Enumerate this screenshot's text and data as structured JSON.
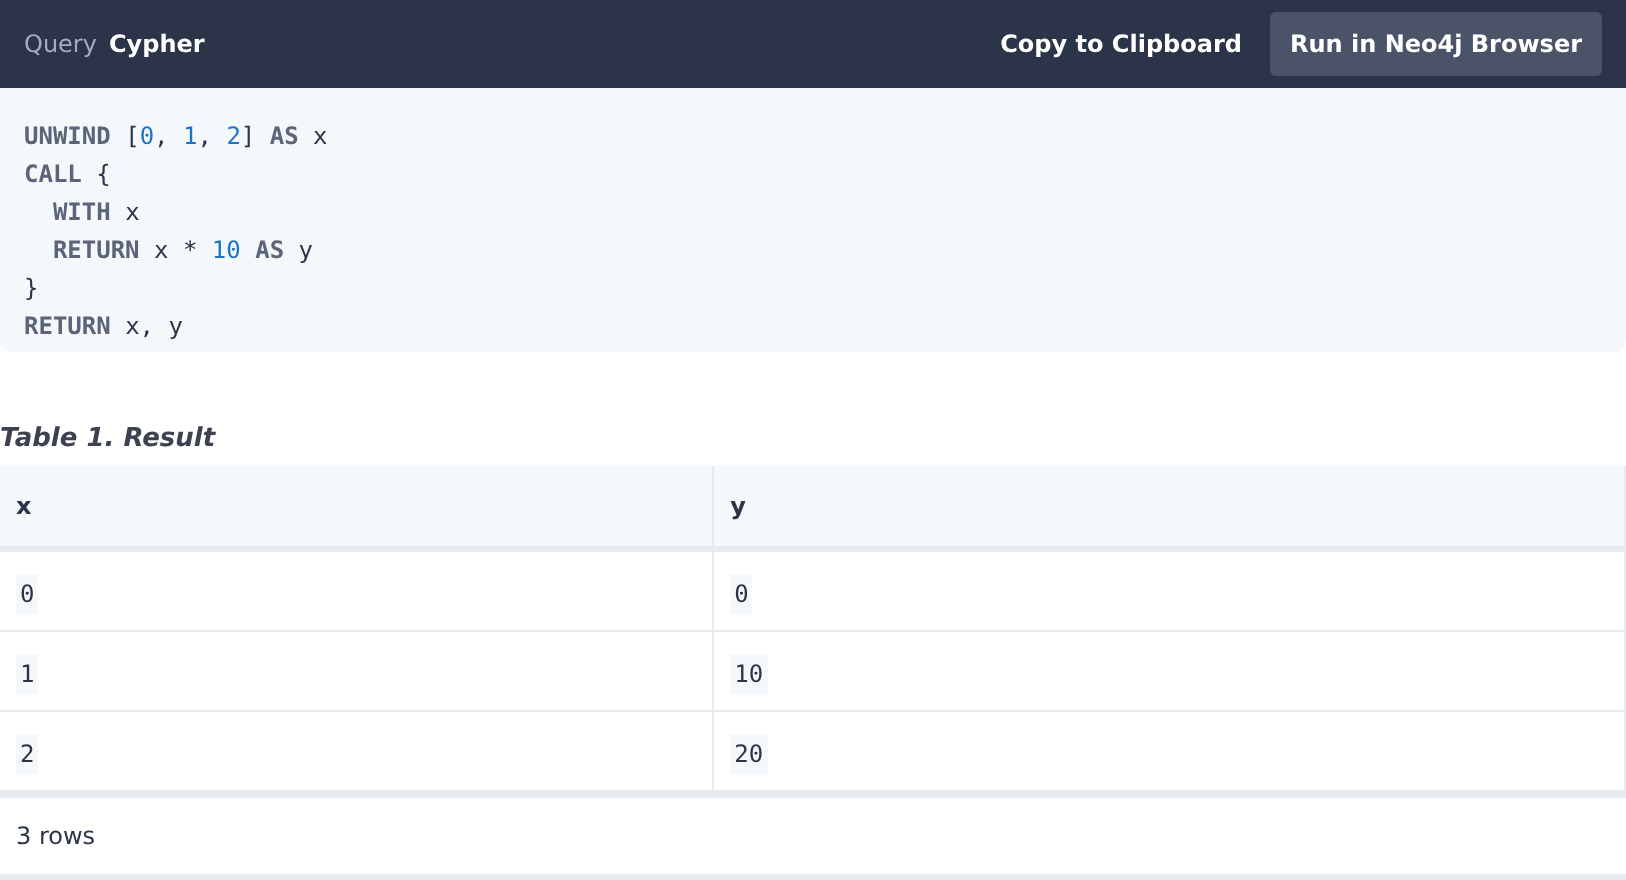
{
  "header": {
    "label": "Query",
    "language": "Cypher",
    "actions": [
      {
        "label": "Copy to Clipboard",
        "kind": "link"
      },
      {
        "label": "Run in Neo4j Browser",
        "kind": "button"
      }
    ]
  },
  "code": [
    [
      {
        "kind": "keyword",
        "text": "UNWIND"
      },
      {
        "kind": "plain",
        "text": " ["
      },
      {
        "kind": "number",
        "text": "0"
      },
      {
        "kind": "plain",
        "text": ", "
      },
      {
        "kind": "number",
        "text": "1"
      },
      {
        "kind": "plain",
        "text": ", "
      },
      {
        "kind": "number",
        "text": "2"
      },
      {
        "kind": "plain",
        "text": "] "
      },
      {
        "kind": "keyword",
        "text": "AS"
      },
      {
        "kind": "plain",
        "text": " x"
      }
    ],
    [
      {
        "kind": "keyword",
        "text": "CALL"
      },
      {
        "kind": "plain",
        "text": " {"
      }
    ],
    {
      "indented": true,
      "tokens": [
        {
          "kind": "keyword",
          "text": "WITH"
        },
        {
          "kind": "plain",
          "text": " x"
        }
      ]
    },
    {
      "indented": true,
      "tokens": [
        {
          "kind": "keyword",
          "text": "RETURN"
        },
        {
          "kind": "plain",
          "text": " x * "
        },
        {
          "kind": "number",
          "text": "10"
        },
        {
          "kind": "keyword",
          "text": " AS"
        },
        {
          "kind": "plain",
          "text": " y"
        }
      ]
    },
    [
      {
        "kind": "plain",
        "text": "}"
      }
    ],
    [
      {
        "kind": "keyword",
        "text": "RETURN"
      },
      {
        "kind": "plain",
        "text": " x, y"
      }
    ]
  ],
  "table": {
    "caption": "Table 1. Result",
    "columns": [
      "x",
      "y"
    ],
    "rows": [
      [
        "0",
        "0"
      ],
      [
        "1",
        "10"
      ],
      [
        "2",
        "20"
      ]
    ],
    "footer": "3 rows"
  }
}
